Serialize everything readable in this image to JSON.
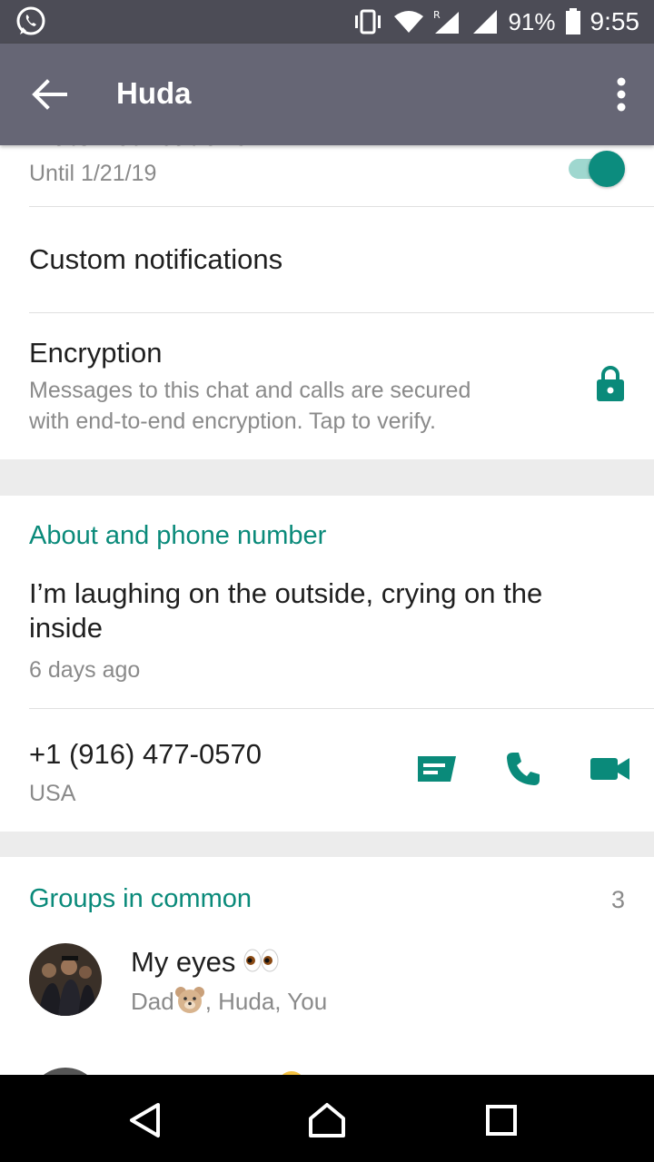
{
  "status_bar": {
    "battery_pct": "91%",
    "time": "9:55",
    "roaming_label": "R"
  },
  "app_bar": {
    "title": "Huda"
  },
  "mute": {
    "title": "Mute notifications",
    "subtitle": "Until 1/21/19",
    "enabled": true
  },
  "custom_notifications": {
    "title": "Custom notifications"
  },
  "encryption": {
    "title": "Encryption",
    "description_line1": "Messages to this chat and calls are secured",
    "description_line2": "with end-to-end encryption. Tap to verify."
  },
  "about": {
    "section_title": "About and phone number",
    "status_line1": "I’m laughing on the outside, crying on the",
    "status_line2": "inside",
    "status_time": "6 days ago",
    "phone": "+1 (916) 477-0570",
    "country": "USA"
  },
  "groups": {
    "section_title": "Groups in common",
    "count": "3",
    "items": [
      {
        "name": "My eyes",
        "members": ", Huda, You",
        "members_prefix": "Dad"
      }
    ]
  },
  "colors": {
    "accent": "#0a8a7a",
    "app_bar": "#666675",
    "status_bar": "#4c4c56"
  }
}
